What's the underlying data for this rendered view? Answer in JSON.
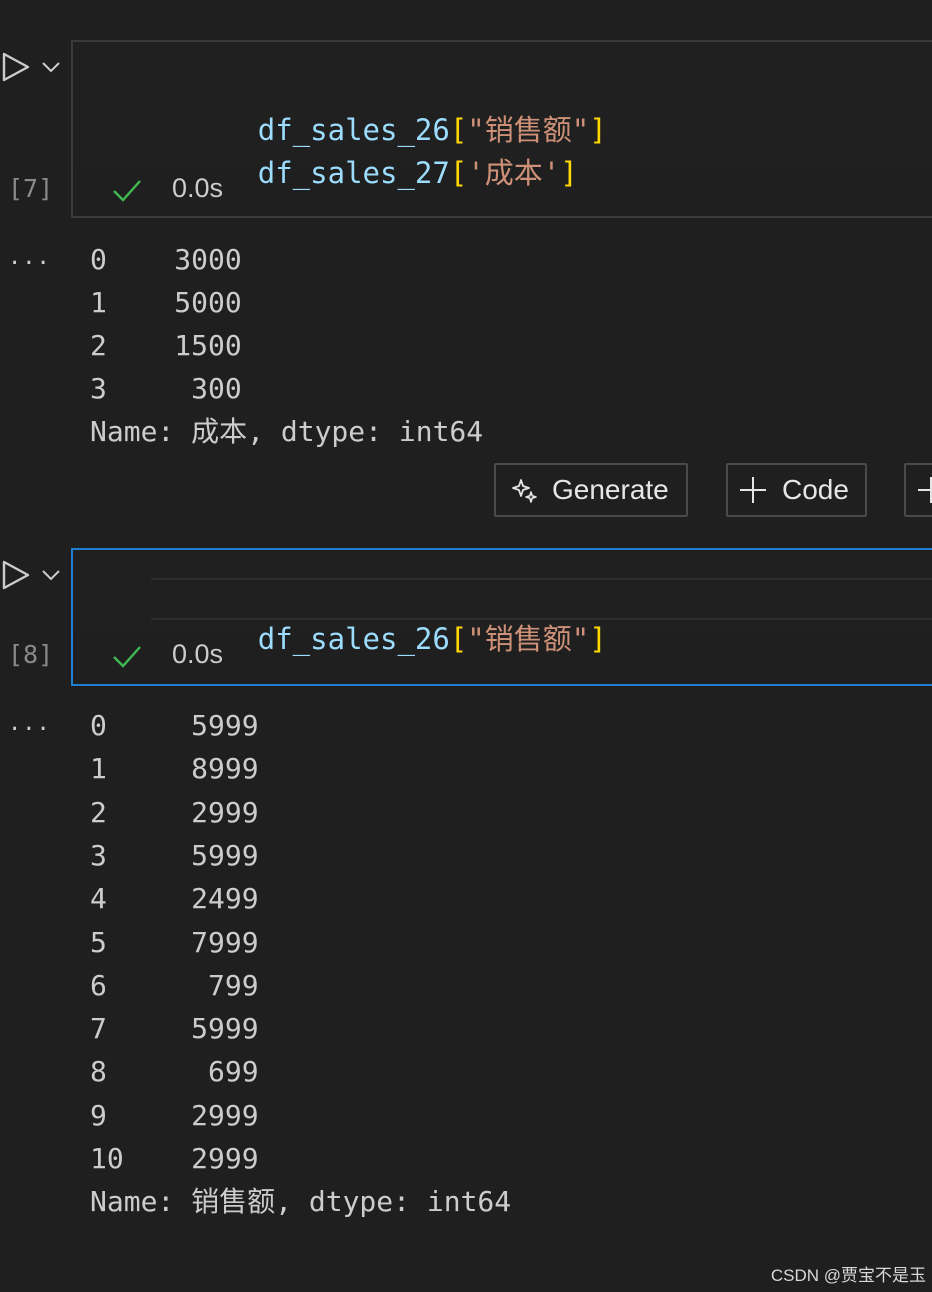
{
  "cell7": {
    "code_lines": [
      {
        "var": "df_sales_26",
        "open": "[",
        "str": "\"销售额\"",
        "close": "]"
      },
      {
        "var": "df_sales_27",
        "open": "[",
        "str": "'成本'",
        "close": "]"
      }
    ],
    "exec_count": "[7]",
    "status_time": "0.0s",
    "output_ellipsis": "...",
    "output_lines": [
      "0    3000",
      "1    5000",
      "2    1500",
      "3     300",
      "Name: 成本, dtype: int64"
    ]
  },
  "toolbar": {
    "generate_label": "Generate",
    "code_label": "Code"
  },
  "cell8": {
    "code_lines": [
      {
        "var": "df_sales_26",
        "open": "[",
        "str": "\"销售额\"",
        "close": "]"
      }
    ],
    "exec_count": "[8]",
    "status_time": "0.0s",
    "output_ellipsis": "...",
    "output_lines": [
      "0     5999",
      "1     8999",
      "2     2999",
      "3     5999",
      "4     2499",
      "5     7999",
      "6      799",
      "7     5999",
      "8      699",
      "9     2999",
      "10    2999",
      "Name: 销售额, dtype: int64"
    ]
  },
  "watermark": "CSDN @贾宝不是玉",
  "icons": {
    "run": "run-icon",
    "chevron": "chevron-down-icon",
    "check": "check-icon",
    "sparkle": "sparkle-icon",
    "plus": "plus-icon"
  },
  "colors": {
    "background": "#1f1f1f",
    "focus_border": "#1f7fd4",
    "variable": "#9cdcfe",
    "bracket": "#ffd700",
    "string": "#ce9178",
    "success": "#3fb950"
  }
}
